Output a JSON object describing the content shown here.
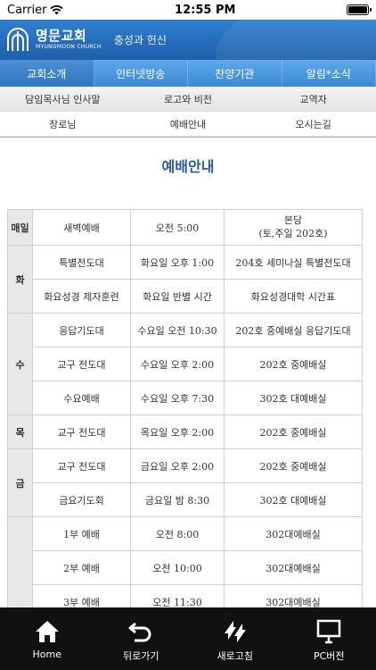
{
  "status": {
    "carrier": "Carrier",
    "time": "12:55 PM",
    "battery_level": 1.0
  },
  "banner": {
    "church_name_ko": "명문교회",
    "church_name_en": "MYUNGMOON CHURCH",
    "slogan": "충성과 헌신"
  },
  "nav": {
    "items": [
      "교회소개",
      "인터넷방송",
      "찬양기관",
      "알림*소식"
    ]
  },
  "submenu": {
    "items": [
      "담임목사님 인사말",
      "로고와 비전",
      "교역자",
      "장로님",
      "예배안내",
      "오시는길"
    ]
  },
  "page_title": "예배안내",
  "schedule": {
    "daily": {
      "day": "매일",
      "name": "새벽예배",
      "time": "오전 5:00",
      "place_line1": "본당",
      "place_line2": "(토,주일 202호)"
    },
    "tue": {
      "day": "화",
      "rows": [
        {
          "name": "특별전도대",
          "time": "화요일 오후 1:00",
          "place": "204호 세미나실 특별전도대"
        },
        {
          "name": "화요성경 제자훈련",
          "time": "화요일 반별 시간",
          "place": "화요성경대학 시간표"
        }
      ]
    },
    "wed": {
      "day": "수",
      "rows": [
        {
          "name": "응답기도대",
          "time": "수요일 오전 10:30",
          "place": "202호 중예배실 응답기도대"
        },
        {
          "name": "교구 전도대",
          "time": "수요일 오후 2:00",
          "place": "202호 중예배실"
        },
        {
          "name": "수요예배",
          "time": "수요일 오후 7:30",
          "place": "302호 대예배실"
        }
      ]
    },
    "thu": {
      "day": "목",
      "rows": [
        {
          "name": "교구 전도대",
          "time": "목요일 오후 2:00",
          "place": "202호 중예배실"
        }
      ]
    },
    "fri": {
      "day": "금",
      "rows": [
        {
          "name": "교구 전도대",
          "time": "금요일 오후 2:00",
          "place": "202호 중예배실"
        },
        {
          "name": "금요기도회",
          "time": "금요일 밤 8:30",
          "place": "302호 대예배실"
        }
      ]
    },
    "sun": {
      "day": "",
      "rows": [
        {
          "name": "1부 예배",
          "time": "오전 8:00",
          "place": "302대예배실"
        },
        {
          "name": "2부 예배",
          "time": "오전 10:00",
          "place": "302대예배실"
        },
        {
          "name": "3부 예배",
          "time": "오전 11:30",
          "place": "302대예배실"
        }
      ]
    }
  },
  "tabbar": {
    "items": [
      {
        "label": "Home",
        "icon": "home-icon"
      },
      {
        "label": "뒤로가기",
        "icon": "back-icon"
      },
      {
        "label": "새로고침",
        "icon": "refresh-icon"
      },
      {
        "label": "PC버전",
        "icon": "monitor-icon"
      }
    ]
  }
}
